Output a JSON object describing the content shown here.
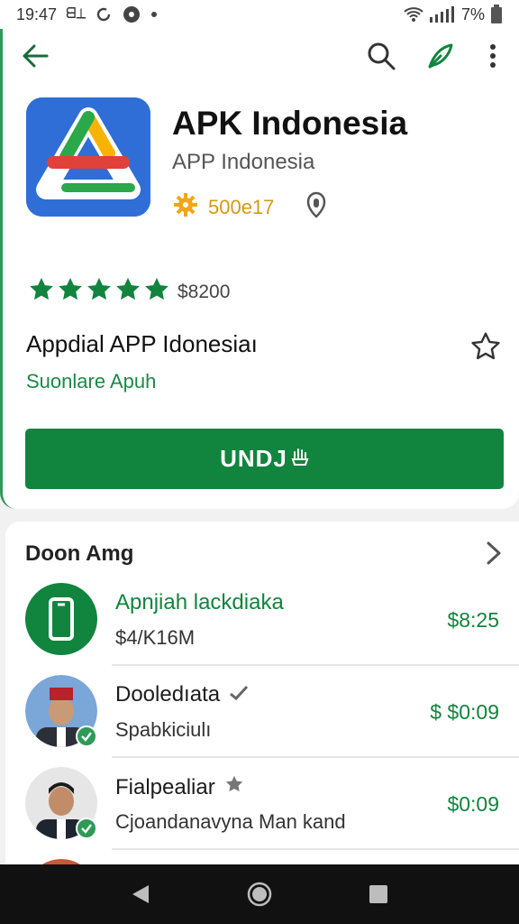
{
  "status_bar": {
    "time": "19:47",
    "notification_glyph": "ᗺ⊥",
    "battery_text": "7%",
    "icons": [
      "whatsapp-icon",
      "circle-dot-icon",
      "dot-icon",
      "wifi-icon",
      "signal-icon",
      "battery-icon"
    ]
  },
  "toolbar": {
    "icons": [
      "back-arrow-icon",
      "search-icon",
      "feather-edit-icon",
      "more-vert-icon"
    ]
  },
  "app": {
    "title": "APK Indonesia",
    "developer": "APP Indonesia",
    "meta_badge_text": "500e17",
    "rating_stars": 5,
    "rating_count": "$8200",
    "promo_title": "Appdial APP Idonesiaı",
    "promo_subtitle": "Suonlare Apuh",
    "install_label": "UNDJ"
  },
  "section": {
    "heading": "Doon Amg",
    "rows": [
      {
        "name": "Apnjiah lackdiaka",
        "sub": "$4/K16M",
        "price": "$8:25",
        "name_green": true,
        "avatar": "phone-icon"
      },
      {
        "name": "Dooledıata",
        "sub": "Spabkiciulı",
        "price": "$ $0:09",
        "name_green": false,
        "avatar": "person-avatar-fez"
      },
      {
        "name": "Fialpealiar",
        "sub": "Cjoandanavyna Man kand",
        "price": "$0:09",
        "name_green": false,
        "avatar": "person-avatar-suit"
      }
    ]
  },
  "colors": {
    "accent": "#11843e",
    "star": "#11843e",
    "meta": "#d49a14",
    "icon_bg": "#2f6ed6"
  },
  "nav": {
    "icons": [
      "nav-back-icon",
      "nav-home-icon",
      "nav-recents-icon"
    ]
  }
}
